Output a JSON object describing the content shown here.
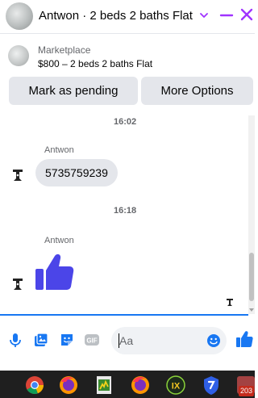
{
  "header": {
    "title": "Antwon · 2 beds 2 baths Flat",
    "accent_color": "#a033ff"
  },
  "listing": {
    "source_label": "Marketplace",
    "summary": "$800 – 2 beds 2 baths Flat",
    "mark_pending_label": "Mark as pending",
    "more_options_label": "More Options"
  },
  "messages": {
    "timestamp_1": "16:02",
    "sender_1": "Antwon",
    "text_1": "5735759239",
    "timestamp_2": "16:18",
    "sender_2": "Antwon",
    "reaction_2": "thumbs-up",
    "reaction_color": "#4b45e8"
  },
  "composer": {
    "placeholder": "Aa",
    "gif_label": "GIF",
    "icon_color": "#1877f2",
    "icons": [
      "mic-icon",
      "photo-icon",
      "sticker-icon",
      "gif-icon",
      "emoji-icon",
      "like-icon"
    ]
  },
  "taskbar": {
    "apps": [
      "chrome-icon",
      "firefox-icon",
      "spreadsheet-icon",
      "firefox-icon",
      "ix-icon",
      "shield-icon",
      "app-icon"
    ],
    "badge": "203"
  }
}
